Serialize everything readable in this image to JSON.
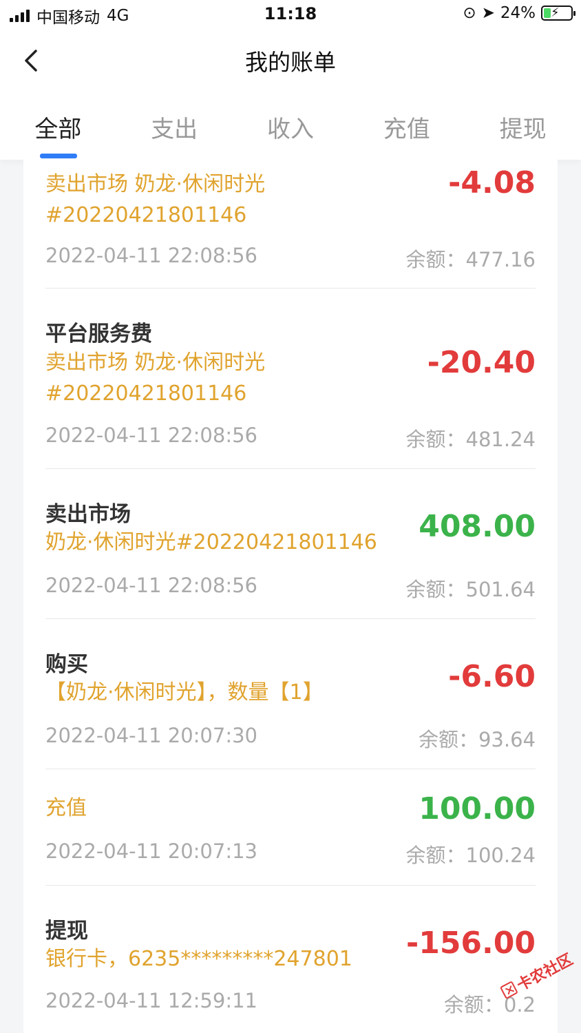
{
  "status_bar": {
    "carrier": "中国移动",
    "network": "4G",
    "time": "11:18",
    "battery": "24%"
  },
  "nav": {
    "title": "我的账单"
  },
  "tabs": [
    {
      "label": "全部",
      "active": true
    },
    {
      "label": "支出",
      "active": false
    },
    {
      "label": "收入",
      "active": false
    },
    {
      "label": "充值",
      "active": false
    },
    {
      "label": "提现",
      "active": false
    }
  ],
  "transactions": [
    {
      "title": "",
      "desc": [
        "卖出市场 奶龙·休闲时光",
        "#20220421801146"
      ],
      "amount": "-4.08",
      "type": "negative",
      "time": "2022-04-11 22:08:56",
      "balance": "余额：477.16"
    },
    {
      "title": "平台服务费",
      "desc": [
        "卖出市场 奶龙·休闲时光",
        "#20220421801146"
      ],
      "amount": "-20.40",
      "type": "negative",
      "time": "2022-04-11 22:08:56",
      "balance": "余额：481.24"
    },
    {
      "title": "卖出市场",
      "desc": [
        "奶龙·休闲时光#20220421801146"
      ],
      "amount": "408.00",
      "type": "positive",
      "time": "2022-04-11 22:08:56",
      "balance": "余额：501.64"
    },
    {
      "title": "购买",
      "desc": [
        "【奶龙·休闲时光】，数量【1】"
      ],
      "amount": "-6.60",
      "type": "negative",
      "time": "2022-04-11 20:07:30",
      "balance": "余额：93.64"
    },
    {
      "title": "",
      "desc": [
        "充值"
      ],
      "amount": "100.00",
      "type": "positive",
      "time": "2022-04-11 20:07:13",
      "balance": "余额：100.24"
    },
    {
      "title": "提现",
      "desc": [
        "银行卡，6235*********247801"
      ],
      "amount": "-156.00",
      "type": "negative",
      "time": "2022-04-11 12:59:11",
      "balance": "余额：0.2"
    }
  ],
  "watermark": "卡农社区",
  "colors": {
    "accent": "#2f7df6",
    "negative": "#e23b3b",
    "positive": "#3bb34a",
    "desc": "#e0a32e"
  }
}
